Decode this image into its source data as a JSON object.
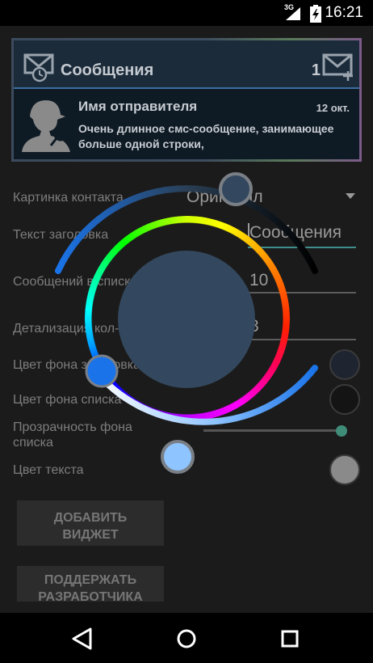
{
  "status_bar": {
    "time": "16:21",
    "network": "3G"
  },
  "widget": {
    "title": "Сообщения",
    "count": "1",
    "sender_name": "Имя отправителя",
    "date": "12 окт.",
    "message": "Очень длинное смс-сообщение, занимающее больше одной строки,"
  },
  "settings": {
    "contact_image": {
      "label": "Картинка контакта",
      "value": "Оригинал"
    },
    "header_text": {
      "label": "Текст заголовка",
      "value": "Сообщения"
    },
    "messages_in_list": {
      "label": "Сообщений в списке",
      "value": "10"
    },
    "detail": {
      "label": "Детализация кол-ва",
      "value": "3"
    },
    "title_bg_color": {
      "label": "Цвет фона заголовка",
      "color": "#1e2530"
    },
    "list_bg_color": {
      "label": "Цвет фона списка",
      "color": "#141414"
    },
    "list_bg_opacity": {
      "label": "Прозрачность фона списка",
      "level": 0.98
    },
    "text_color": {
      "label": "Цвет текста",
      "color": "#8a8a8a"
    }
  },
  "buttons": {
    "add_widget": "ДОБАВИТЬ ВИДЖЕТ",
    "support_dev": "ПОДДЕРЖАТЬ РАЗРАБОТЧИКА"
  },
  "color_picker": {
    "selected_color": "#33485e",
    "hue_thumb_color": "#1a73e8",
    "saturation_thumb_color": "#8ec4ff",
    "value_thumb_color": "#33485e"
  },
  "nav": {
    "back_icon": "back-icon",
    "home_icon": "home-icon",
    "recents_icon": "recents-icon"
  }
}
